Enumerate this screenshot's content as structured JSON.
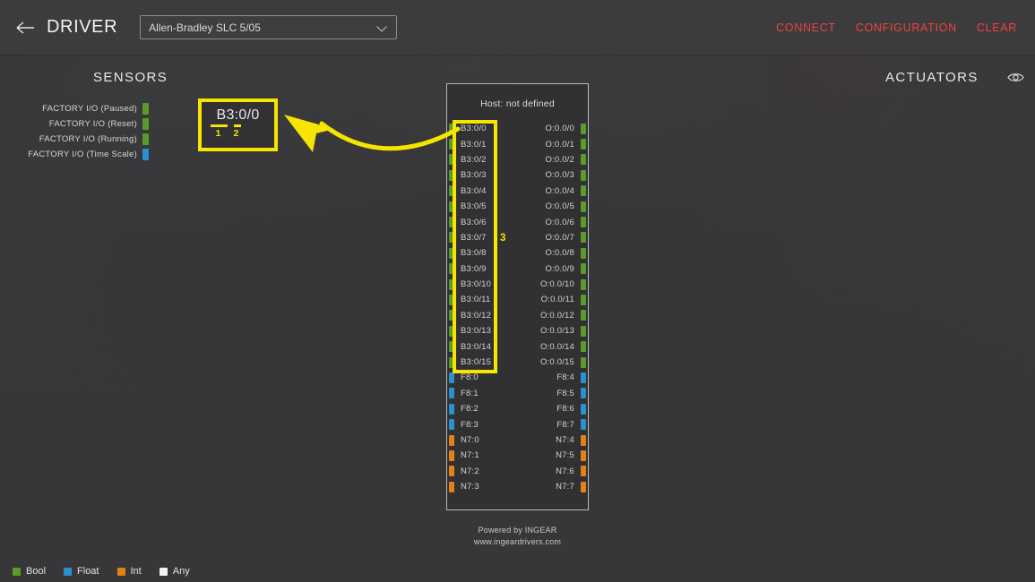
{
  "header": {
    "back_icon": "arrow-left-icon",
    "title": "DRIVER",
    "driver_select": {
      "value": "Allen-Bradley SLC 5/05",
      "chevron_icon": "chevron-down-icon"
    },
    "actions": [
      {
        "label": "CONNECT"
      },
      {
        "label": "CONFIGURATION"
      },
      {
        "label": "CLEAR"
      }
    ],
    "action_color": "#f2413c"
  },
  "columns": {
    "sensors_title": "SENSORS",
    "actuators_title": "ACTUATORS",
    "eye_icon": "eye-icon"
  },
  "sensors": [
    {
      "label": "FACTORY I/O (Paused)",
      "color": "#5b9b2b"
    },
    {
      "label": "FACTORY I/O (Reset)",
      "color": "#5b9b2b"
    },
    {
      "label": "FACTORY I/O (Running)",
      "color": "#5b9b2b"
    },
    {
      "label": "FACTORY I/O (Time Scale)",
      "color": "#2b90cf"
    }
  ],
  "panel": {
    "host": "Host: not defined",
    "footer_line1": "Powered by INGEAR",
    "footer_line2": "www.ingeardrivers.com",
    "rows": [
      {
        "left": "B3:0/0",
        "left_color": "#5b9b2b",
        "right": "O:0.0/0",
        "right_color": "#5b9b2b"
      },
      {
        "left": "B3:0/1",
        "left_color": "#5b9b2b",
        "right": "O:0.0/1",
        "right_color": "#5b9b2b"
      },
      {
        "left": "B3:0/2",
        "left_color": "#5b9b2b",
        "right": "O:0.0/2",
        "right_color": "#5b9b2b"
      },
      {
        "left": "B3:0/3",
        "left_color": "#5b9b2b",
        "right": "O:0.0/3",
        "right_color": "#5b9b2b"
      },
      {
        "left": "B3:0/4",
        "left_color": "#5b9b2b",
        "right": "O:0.0/4",
        "right_color": "#5b9b2b"
      },
      {
        "left": "B3:0/5",
        "left_color": "#5b9b2b",
        "right": "O:0.0/5",
        "right_color": "#5b9b2b"
      },
      {
        "left": "B3:0/6",
        "left_color": "#5b9b2b",
        "right": "O:0.0/6",
        "right_color": "#5b9b2b"
      },
      {
        "left": "B3:0/7",
        "left_color": "#5b9b2b",
        "right": "O:0.0/7",
        "right_color": "#5b9b2b"
      },
      {
        "left": "B3:0/8",
        "left_color": "#5b9b2b",
        "right": "O:0.0/8",
        "right_color": "#5b9b2b"
      },
      {
        "left": "B3:0/9",
        "left_color": "#5b9b2b",
        "right": "O:0.0/9",
        "right_color": "#5b9b2b"
      },
      {
        "left": "B3:0/10",
        "left_color": "#5b9b2b",
        "right": "O:0.0/10",
        "right_color": "#5b9b2b"
      },
      {
        "left": "B3:0/11",
        "left_color": "#5b9b2b",
        "right": "O:0.0/11",
        "right_color": "#5b9b2b"
      },
      {
        "left": "B3:0/12",
        "left_color": "#5b9b2b",
        "right": "O:0.0/12",
        "right_color": "#5b9b2b"
      },
      {
        "left": "B3:0/13",
        "left_color": "#5b9b2b",
        "right": "O:0.0/13",
        "right_color": "#5b9b2b"
      },
      {
        "left": "B3:0/14",
        "left_color": "#5b9b2b",
        "right": "O:0.0/14",
        "right_color": "#5b9b2b"
      },
      {
        "left": "B3:0/15",
        "left_color": "#5b9b2b",
        "right": "O:0.0/15",
        "right_color": "#5b9b2b"
      },
      {
        "left": "F8:0",
        "left_color": "#2b90cf",
        "right": "F8:4",
        "right_color": "#2b90cf"
      },
      {
        "left": "F8:1",
        "left_color": "#2b90cf",
        "right": "F8:5",
        "right_color": "#2b90cf"
      },
      {
        "left": "F8:2",
        "left_color": "#2b90cf",
        "right": "F8:6",
        "right_color": "#2b90cf"
      },
      {
        "left": "F8:3",
        "left_color": "#2b90cf",
        "right": "F8:7",
        "right_color": "#2b90cf"
      },
      {
        "left": "N7:0",
        "left_color": "#e08214",
        "right": "N7:4",
        "right_color": "#e08214"
      },
      {
        "left": "N7:1",
        "left_color": "#e08214",
        "right": "N7:5",
        "right_color": "#e08214"
      },
      {
        "left": "N7:2",
        "left_color": "#e08214",
        "right": "N7:6",
        "right_color": "#e08214"
      },
      {
        "left": "N7:3",
        "left_color": "#e08214",
        "right": "N7:7",
        "right_color": "#e08214"
      }
    ]
  },
  "annotation": {
    "color": "#f5e500",
    "callout_text": "B3:0/0",
    "mark_1": "1",
    "mark_2": "2",
    "mark_3": "3"
  },
  "legend": [
    {
      "label": "Bool",
      "color": "#5b9b2b"
    },
    {
      "label": "Float",
      "color": "#2b90cf"
    },
    {
      "label": "Int",
      "color": "#e08214"
    },
    {
      "label": "Any",
      "color": "#f2f2f2"
    }
  ]
}
